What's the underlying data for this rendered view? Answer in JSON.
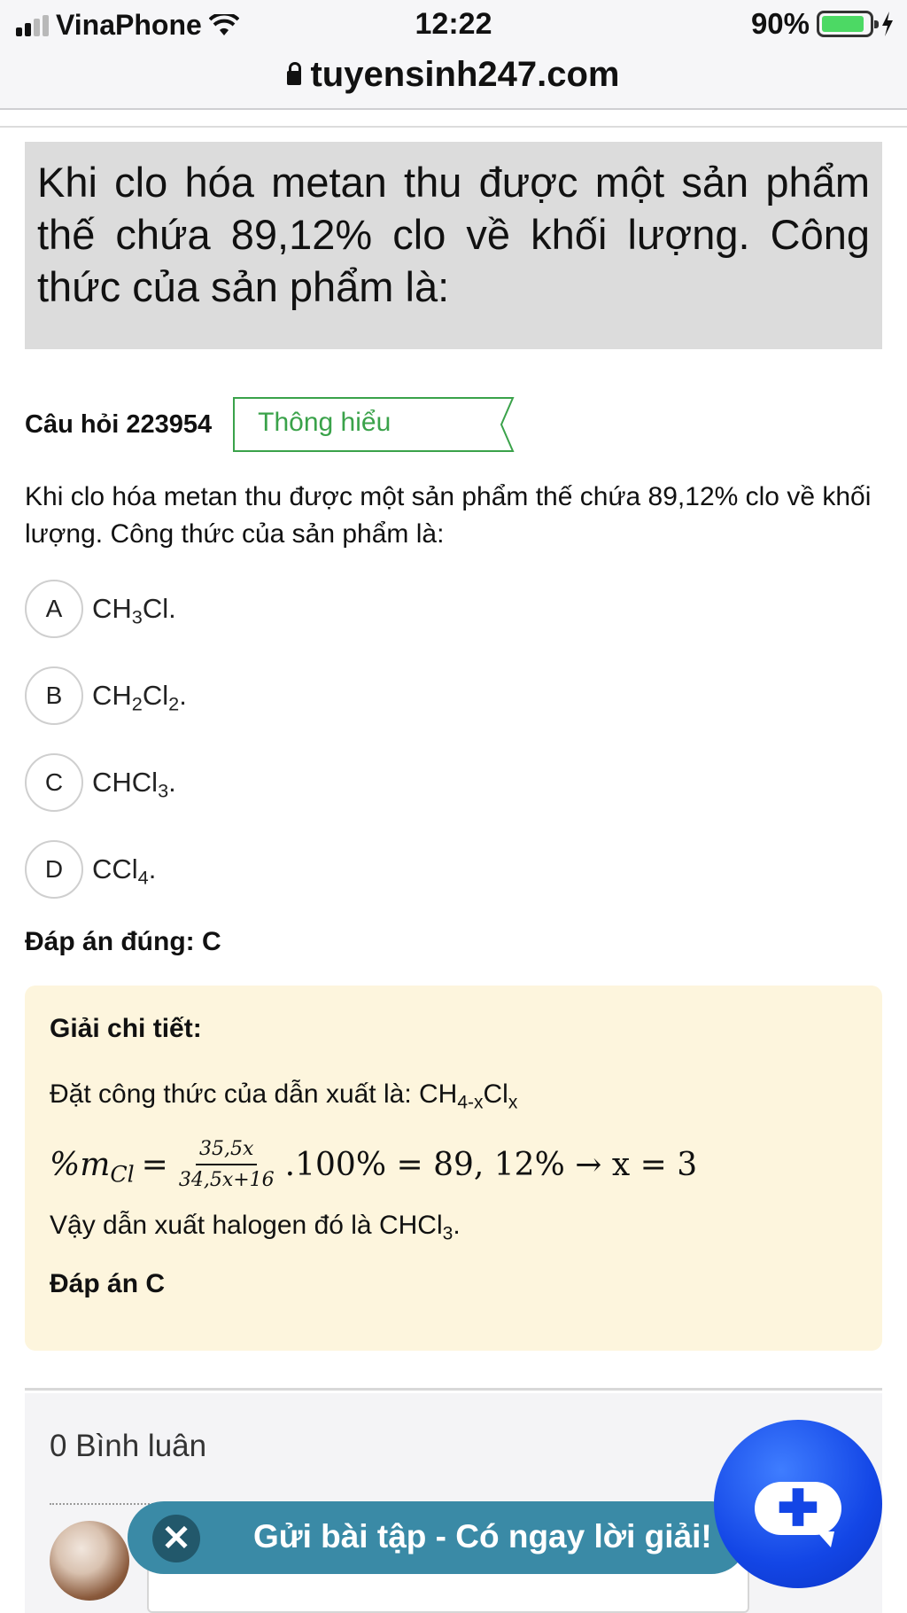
{
  "status_bar": {
    "carrier": "VinaPhone",
    "time": "12:22",
    "battery_pct": "90%",
    "battery_level": 0.9,
    "signal_bars_active": 2,
    "signal_bars_total": 4
  },
  "browser": {
    "url": "tuyensinh247.com"
  },
  "page": {
    "title": "Khi clo hóa metan thu được một sản phẩm thế chứa 89,12% clo về khối lượng. Công thức của sản phẩm là:"
  },
  "question": {
    "id_label": "Câu hỏi 223954",
    "level": "Thông hiểu",
    "text": "Khi clo hóa metan thu được một sản phẩm thế chứa 89,12% clo về khối lượng. Công thức của sản phẩm là:",
    "options": [
      {
        "key": "A",
        "parts": [
          "CH",
          "3",
          "Cl."
        ]
      },
      {
        "key": "B",
        "parts": [
          "CH",
          "2",
          "Cl",
          "2",
          "."
        ]
      },
      {
        "key": "C",
        "parts": [
          "CHCl",
          "3",
          "."
        ]
      },
      {
        "key": "D",
        "parts": [
          "CCl",
          "4",
          "."
        ]
      }
    ]
  },
  "correct_answer": "Đáp án đúng: C",
  "solution": {
    "title": "Giải chi tiết:",
    "line1_prefix": "Đặt công thức của dẫn xuất là: CH",
    "line1_sub1": "4-x",
    "line1_mid": "Cl",
    "line1_sub2": "x",
    "formula_lhs": "%m",
    "formula_lhs_sub": "Cl",
    "formula_eq": "=",
    "formula_num": "35,5x",
    "formula_den": "34,5x+16",
    "formula_rhs": ".100% = 89, 12% → x = 3",
    "line3_prefix": "Vậy dẫn xuất halogen đó là CHCl",
    "line3_sub": "3",
    "line3_suffix": ".",
    "final": "Đáp án C"
  },
  "comments": {
    "count_label": "0 Bình luân"
  },
  "promo": {
    "close_symbol": "✕",
    "text": "Gửi bài tập - Có ngay lời giải!"
  },
  "fab": {
    "symbol": "✚"
  },
  "colors": {
    "title_bg": "#dcdcdc",
    "level_green": "#3aa24a",
    "solution_bg": "#fdf5dd",
    "promo_bg": "#3a8aa6",
    "fab_blue": "#1346e6"
  }
}
